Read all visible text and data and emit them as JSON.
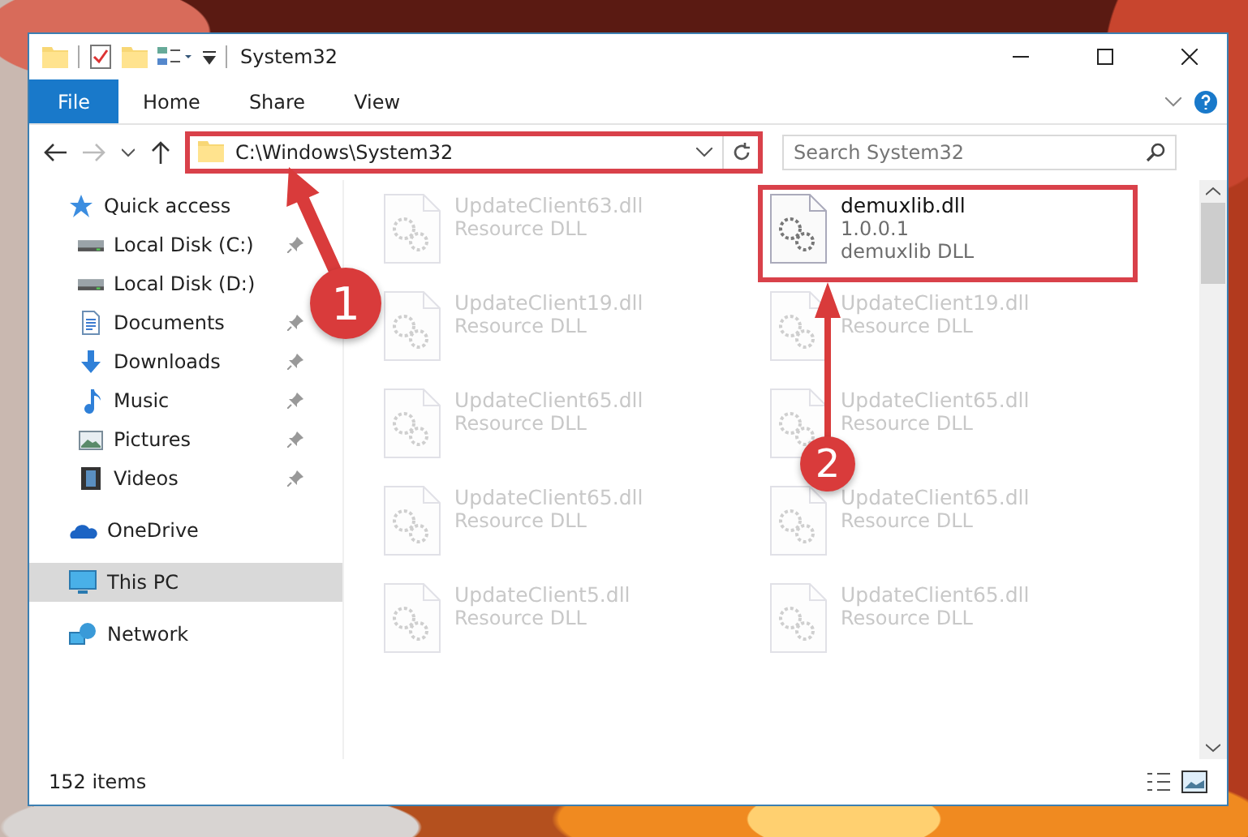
{
  "window": {
    "title": "System32"
  },
  "ribbon": {
    "file_tab": "File",
    "tabs": [
      "Home",
      "Share",
      "View"
    ]
  },
  "address": {
    "path": "C:\\Windows\\System32",
    "highlighted": true
  },
  "search": {
    "placeholder": "Search System32"
  },
  "sidebar": {
    "items": [
      {
        "label": "Quick access",
        "kind": "quick",
        "selected": false,
        "children": [
          {
            "label": "Local Disk (C:)",
            "kind": "disk",
            "pinned": true
          },
          {
            "label": "Local Disk (D:)",
            "kind": "disk",
            "pinned": false
          },
          {
            "label": "Documents",
            "kind": "documents",
            "pinned": true
          },
          {
            "label": "Downloads",
            "kind": "downloads",
            "pinned": true
          },
          {
            "label": "Music",
            "kind": "music",
            "pinned": true
          },
          {
            "label": "Pictures",
            "kind": "pictures",
            "pinned": true
          },
          {
            "label": "Videos",
            "kind": "videos",
            "pinned": true
          }
        ]
      },
      {
        "label": "OneDrive",
        "kind": "cloud",
        "selected": false
      },
      {
        "label": "This PC",
        "kind": "pc",
        "selected": true
      },
      {
        "label": "Network",
        "kind": "network",
        "selected": false
      }
    ]
  },
  "files": [
    {
      "name": "UpdateClient63.dll",
      "description": "Resource DLL",
      "faded": true,
      "highlighted": false
    },
    {
      "name": "demuxlib.dll",
      "version": "1.0.0.1",
      "description": "demuxlib DLL",
      "faded": false,
      "highlighted": true
    },
    {
      "name": "UpdateClient19.dll",
      "description": "Resource DLL",
      "faded": true,
      "highlighted": false
    },
    {
      "name": "UpdateClient19.dll",
      "description": "Resource DLL",
      "faded": true,
      "highlighted": false
    },
    {
      "name": "UpdateClient65.dll",
      "description": "Resource DLL",
      "faded": true,
      "highlighted": false
    },
    {
      "name": "UpdateClient65.dll",
      "description": "Resource DLL",
      "faded": true,
      "highlighted": false
    },
    {
      "name": "UpdateClient65.dll",
      "description": "Resource DLL",
      "faded": true,
      "highlighted": false
    },
    {
      "name": "UpdateClient65.dll",
      "description": "Resource DLL",
      "faded": true,
      "highlighted": false
    },
    {
      "name": "UpdateClient5.dll",
      "description": "Resource DLL",
      "faded": true,
      "highlighted": false
    },
    {
      "name": "UpdateClient65.dll",
      "description": "Resource DLL",
      "faded": true,
      "highlighted": false
    }
  ],
  "status_bar": {
    "item_count": "152 items"
  },
  "annotations": [
    {
      "label": "1"
    },
    {
      "label": "2"
    }
  ]
}
